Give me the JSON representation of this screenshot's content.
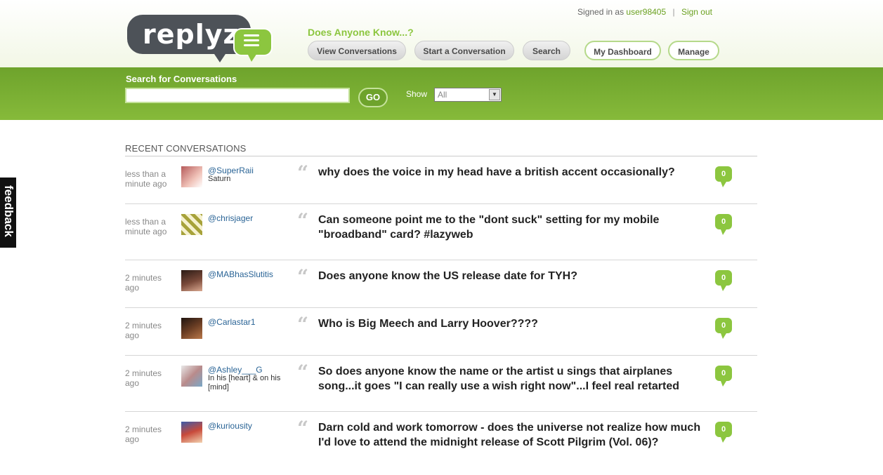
{
  "brand": {
    "logo_text": "replyz",
    "tagline": "Does Anyone Know...?"
  },
  "account": {
    "signed_in_label": "Signed in as",
    "username": "user98405",
    "separator": "|",
    "sign_out": "Sign out"
  },
  "nav": [
    {
      "label": "View Conversations"
    },
    {
      "label": "Start a Conversation"
    },
    {
      "label": "Search"
    },
    {
      "label": "My Dashboard"
    },
    {
      "label": "Manage"
    }
  ],
  "search": {
    "label": "Search for Conversations",
    "value": "",
    "go_label": "GO",
    "show_label": "Show",
    "show_value": "All"
  },
  "feedback_label": "feedback",
  "section_title": "RECENT CONVERSATIONS",
  "colors": {
    "brand_green": "#8cc63f",
    "band_green": "#7bb035",
    "logo_dark": "#4d5258",
    "link_blue": "#2a6496"
  },
  "conversations": [
    {
      "time": "less than a minute ago",
      "user": "@SuperRaii",
      "location": "Saturn",
      "text": "why does the voice in my head have a british accent occasionally?",
      "replies": "0"
    },
    {
      "time": "less than a minute ago",
      "user": "@chrisjager",
      "location": "",
      "text": "Can someone point me to the \"dont suck\" setting for my mobile \"broadband\" card? #lazyweb",
      "replies": "0"
    },
    {
      "time": "2 minutes ago",
      "user": "@MABhasSlutitis",
      "location": "",
      "text": "Does anyone know the US release date for TYH?",
      "replies": "0"
    },
    {
      "time": "2 minutes ago",
      "user": "@Carlastar1",
      "location": "",
      "text": "Who is Big Meech and Larry Hoover????",
      "replies": "0"
    },
    {
      "time": "2 minutes ago",
      "user": "@Ashley___G",
      "location": "In his [heart] & on his [mind]",
      "text": "So does anyone know the name or the artist u sings that airplanes song...it goes \"I can really use a wish right now\"...I feel real retarted",
      "replies": "0"
    },
    {
      "time": "2 minutes ago",
      "user": "@kuriousity",
      "location": "",
      "text": "Darn cold and work tomorrow - does the universe not realize how much I'd love to attend the midnight release of Scott Pilgrim (Vol. 06)?",
      "replies": "0"
    }
  ]
}
